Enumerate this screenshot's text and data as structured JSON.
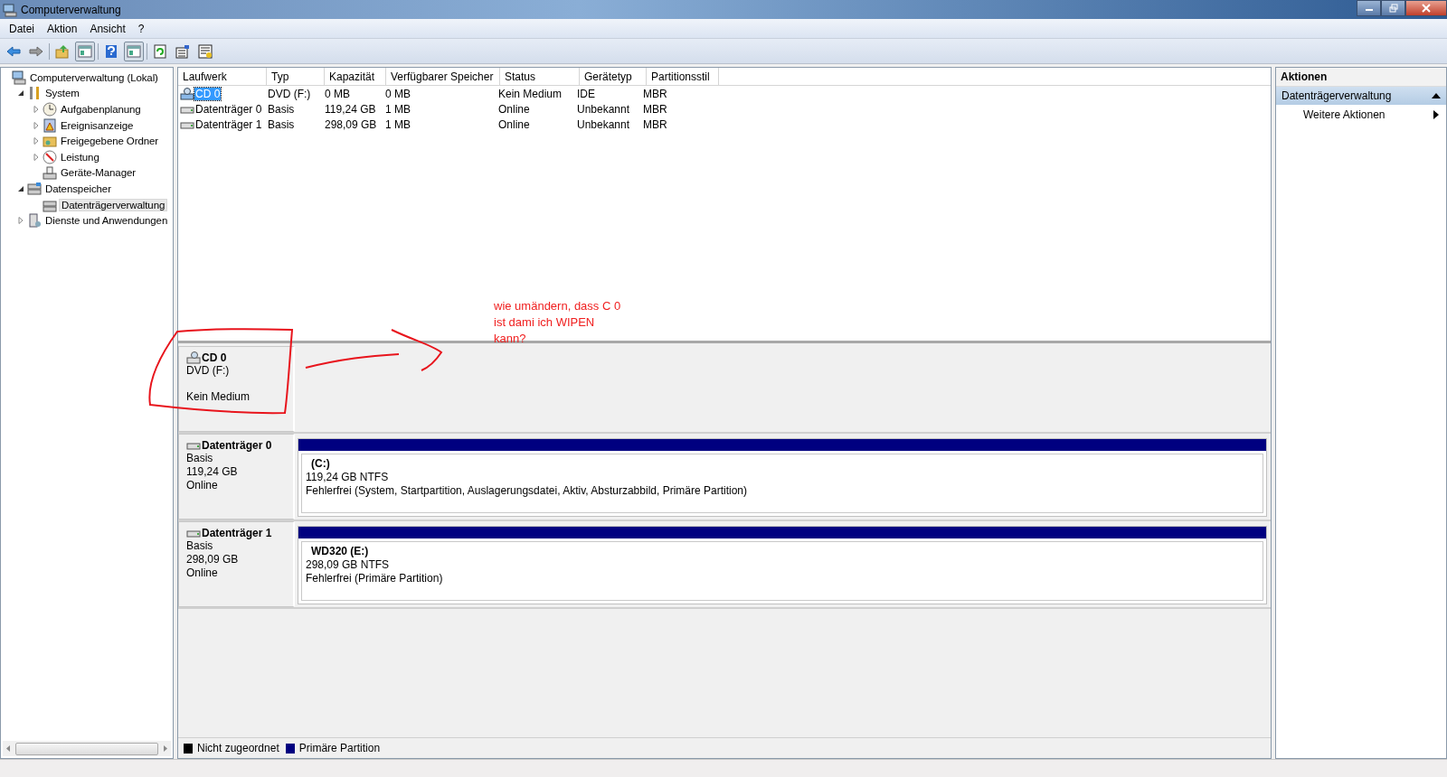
{
  "window": {
    "title": "Computerverwaltung"
  },
  "menu": [
    "Datei",
    "Aktion",
    "Ansicht",
    "?"
  ],
  "toolbar": [
    {
      "kind": "back",
      "selected": false
    },
    {
      "kind": "forward",
      "selected": false
    },
    {
      "kind": "up",
      "selected": false
    },
    {
      "kind": "pane",
      "selected": true
    },
    {
      "kind": "help",
      "selected": false
    },
    {
      "kind": "pane2",
      "selected": true
    },
    {
      "kind": "refresh",
      "selected": false
    },
    {
      "kind": "properties",
      "selected": false
    },
    {
      "kind": "export",
      "selected": false
    }
  ],
  "tree": [
    {
      "label": "Computerverwaltung (Lokal)",
      "selected": false,
      "children": [
        {
          "label": "System",
          "expanded": true,
          "selected": false,
          "children": [
            {
              "label": "Aufgabenplanung",
              "expanded": false,
              "selected": false
            },
            {
              "label": "Ereignisanzeige",
              "expanded": false,
              "selected": false
            },
            {
              "label": "Freigegebene Ordner",
              "expanded": false,
              "selected": false
            },
            {
              "label": "Leistung",
              "expanded": false,
              "selected": false
            },
            {
              "label": "Geräte-Manager",
              "selected": false
            }
          ]
        },
        {
          "label": "Datenspeicher",
          "expanded": true,
          "selected": false,
          "children": [
            {
              "label": "Datenträgerverwaltung",
              "selected": true
            }
          ]
        },
        {
          "label": "Dienste und Anwendungen",
          "expanded": false,
          "selected": false
        }
      ]
    }
  ],
  "table": {
    "columns": [
      "Laufwerk",
      "Typ",
      "Kapazität",
      "Verfügbarer Speicher",
      "Status",
      "Gerätetyp",
      "Partitionsstil"
    ],
    "rows": [
      {
        "kind": "optical",
        "selected": true,
        "cells": [
          "CD 0",
          "DVD (F:)",
          "0 MB",
          "0 MB",
          "Kein Medium",
          "IDE",
          "MBR"
        ]
      },
      {
        "kind": "disk",
        "selected": false,
        "cells": [
          "Datenträger 0",
          "Basis",
          "119,24 GB",
          "1 MB",
          "Online",
          "Unbekannt",
          "MBR"
        ]
      },
      {
        "kind": "disk",
        "selected": false,
        "cells": [
          "Datenträger 1",
          "Basis",
          "298,09 GB",
          "1 MB",
          "Online",
          "Unbekannt",
          "MBR"
        ]
      }
    ]
  },
  "disks": [
    {
      "kind": "optical",
      "name": "CD 0",
      "type": "DVD (F:)",
      "status": "Kein Medium"
    },
    {
      "kind": "disk",
      "name": "Datenträger 0",
      "type": "Basis",
      "capacity": "119,24 GB",
      "status": "Online",
      "partitions": [
        {
          "label": "(C:)",
          "size": "119,24 GB NTFS",
          "status": "Fehlerfrei (System, Startpartition, Auslagerungsdatei, Aktiv, Absturzabbild, Primäre Partition)",
          "color": "#000080"
        }
      ]
    },
    {
      "kind": "disk",
      "name": "Datenträger 1",
      "type": "Basis",
      "capacity": "298,09 GB",
      "status": "Online",
      "partitions": [
        {
          "label": "WD320  (E:)",
          "size": "298,09 GB NTFS",
          "status": "Fehlerfrei (Primäre Partition)",
          "color": "#000080"
        }
      ]
    }
  ],
  "legend": [
    {
      "label": "Nicht zugeordnet",
      "color": "#000000"
    },
    {
      "label": "Primäre Partition",
      "color": "#000080"
    }
  ],
  "actions": {
    "title": "Aktionen",
    "section": "Datenträgerverwaltung",
    "items": [
      "Weitere Aktionen"
    ]
  },
  "annotation": {
    "text": "wie umändern, dass C 0 ist dami ich WIPEN kann?"
  }
}
